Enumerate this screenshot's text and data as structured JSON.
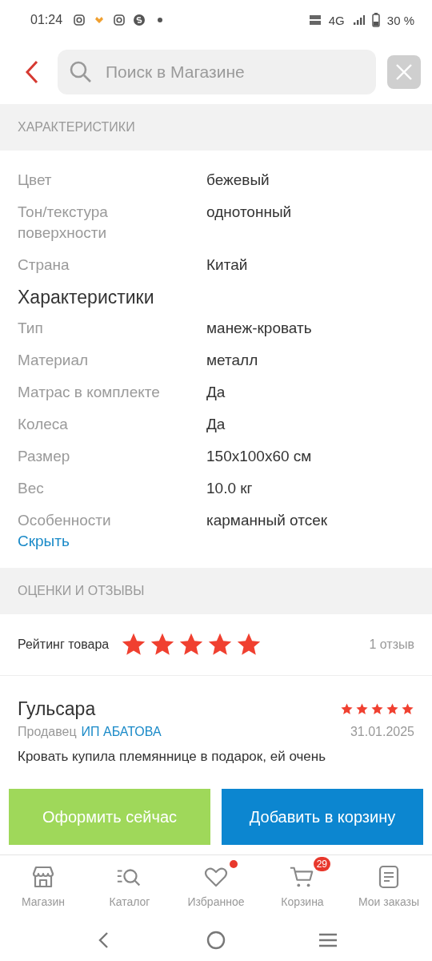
{
  "status_bar": {
    "time": "01:24",
    "network": "4G",
    "battery": "30 %"
  },
  "search": {
    "placeholder": "Поиск в Магазине"
  },
  "specs": {
    "header": "ХАРАКТЕРИСТИКИ",
    "groups": [
      {
        "rows": [
          {
            "label": "Цвет",
            "value": "бежевый"
          },
          {
            "label": "Тон/текстура поверхности",
            "value": "однотонный"
          },
          {
            "label": "Страна",
            "value": "Китай"
          }
        ]
      },
      {
        "title": "Характеристики",
        "rows": [
          {
            "label": "Тип",
            "value": "манеж-кровать"
          },
          {
            "label": "Материал",
            "value": "металл"
          },
          {
            "label": "Матрас в комплекте",
            "value": "Да"
          },
          {
            "label": "Колеса",
            "value": "Да"
          },
          {
            "label": "Размер",
            "value": "150х100х60 см"
          },
          {
            "label": "Вес",
            "value": "10.0 кг"
          },
          {
            "label": "Особенности",
            "value": "карманный отсек"
          }
        ]
      }
    ],
    "toggle": "Скрыть"
  },
  "reviews": {
    "header": "ОЦЕНКИ И ОТЗЫВЫ",
    "rating": {
      "label": "Рейтинг товара",
      "stars": 5,
      "count": "1 отзыв"
    },
    "items": [
      {
        "author": "Гульсара",
        "seller_label": "Продавец",
        "seller": "ИП АБАТОВА",
        "stars": 5,
        "date": "31.01.2025",
        "text": "Кровать купила племяннице в подарок, ей очень"
      }
    ]
  },
  "actions": {
    "checkout": "Оформить сейчас",
    "add_to_cart": "Добавить в корзину"
  },
  "nav": [
    {
      "kind": "store",
      "label": "Магазин",
      "dot": false
    },
    {
      "kind": "catalog",
      "label": "Каталог",
      "dot": false
    },
    {
      "kind": "favorites",
      "label": "Избранное",
      "dot": true
    },
    {
      "kind": "cart",
      "label": "Корзина",
      "dot": false,
      "badge": "29"
    },
    {
      "kind": "orders",
      "label": "Мои заказы",
      "dot": false
    }
  ]
}
